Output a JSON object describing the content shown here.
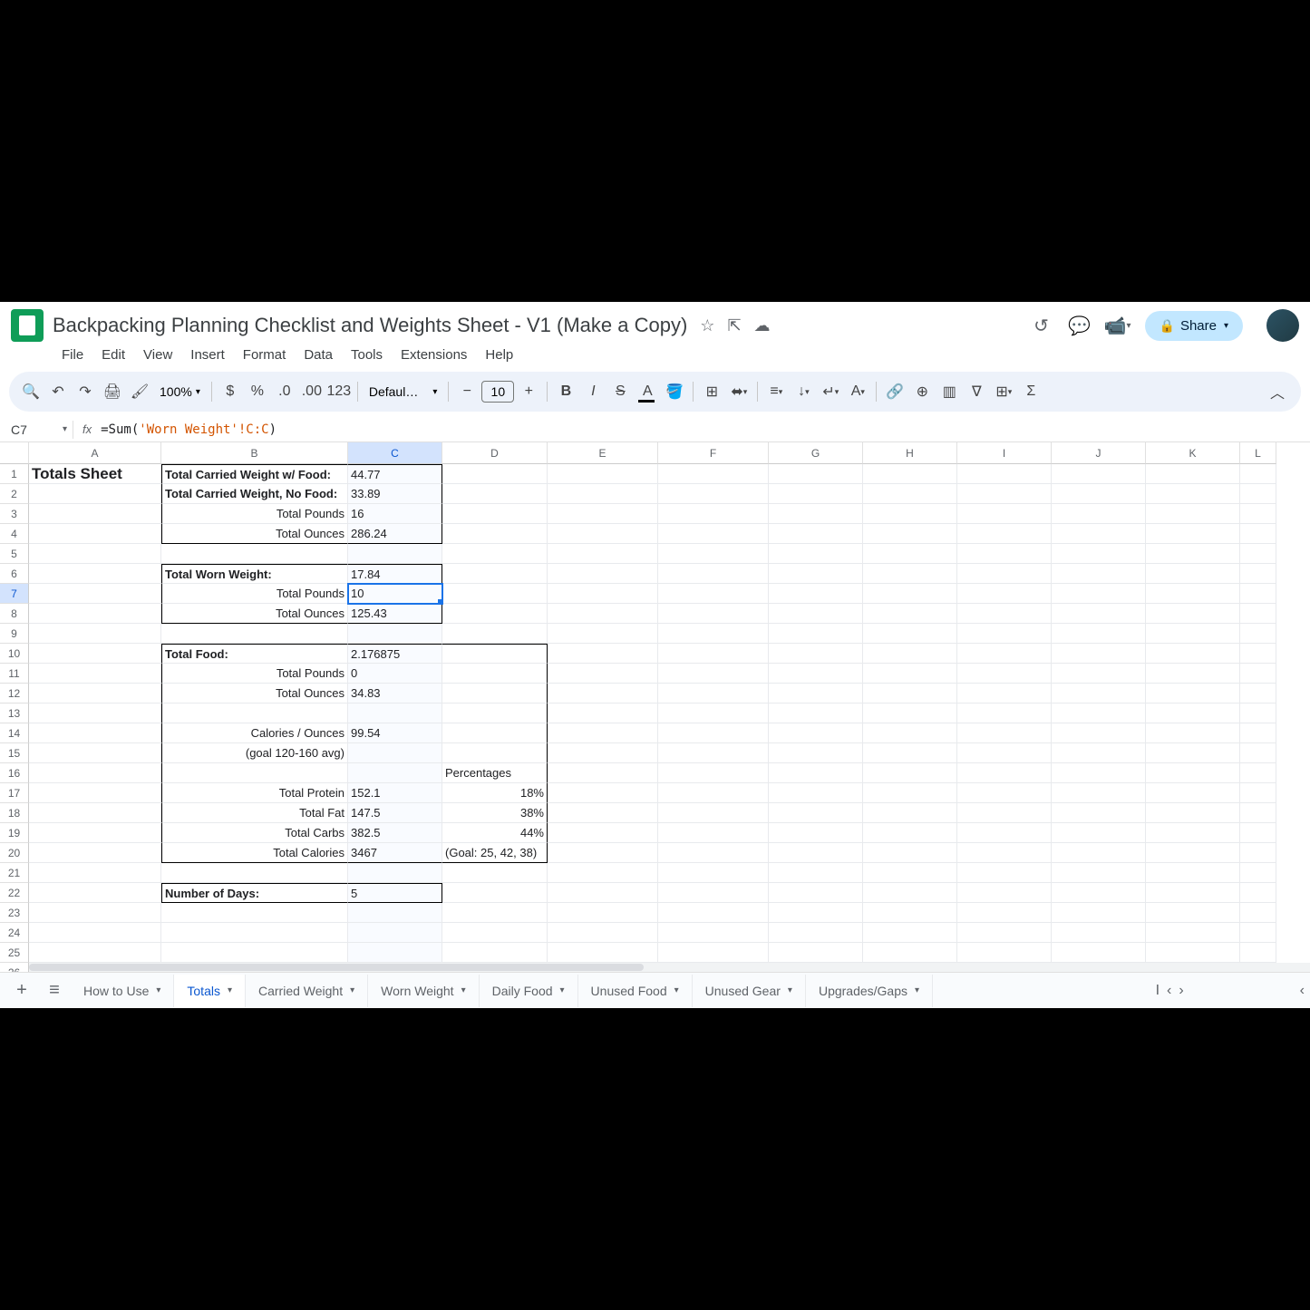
{
  "doc": {
    "title": "Backpacking Planning Checklist and Weights Sheet - V1 (Make a Copy)"
  },
  "menus": [
    "File",
    "Edit",
    "View",
    "Insert",
    "Format",
    "Data",
    "Tools",
    "Extensions",
    "Help"
  ],
  "toolbar": {
    "zoom": "100%",
    "font": "Defaul…",
    "font_size": "10"
  },
  "formula_bar": {
    "cell_ref": "C7",
    "formula_prefix": "=Sum(",
    "formula_str": "'Worn Weight'!C:C",
    "formula_suffix": ")"
  },
  "share": {
    "label": "Share"
  },
  "columns": [
    "A",
    "B",
    "C",
    "D",
    "E",
    "F",
    "G",
    "H",
    "I",
    "J",
    "K",
    "L"
  ],
  "cells": {
    "A1": "Totals Sheet",
    "B1": "Total Carried Weight w/ Food:",
    "C1": "44.77",
    "B2": "Total Carried Weight, No Food:",
    "C2": "33.89",
    "B3": "Total Pounds",
    "C3": "16",
    "B4": "Total Ounces",
    "C4": "286.24",
    "B6": "Total Worn Weight:",
    "C6": "17.84",
    "B7": "Total Pounds",
    "C7": "10",
    "B8": "Total Ounces",
    "C8": "125.43",
    "B10": "Total Food:",
    "C10": "2.176875",
    "B11": "Total Pounds",
    "C11": "0",
    "B12": "Total Ounces",
    "C12": "34.83",
    "B14": "Calories / Ounces",
    "C14": "99.54",
    "B15": "(goal 120-160 avg)",
    "D16": "Percentages",
    "B17": "Total Protein",
    "C17": "152.1",
    "D17": "18%",
    "B18": "Total Fat",
    "C18": "147.5",
    "D18": "38%",
    "B19": "Total Carbs",
    "C19": "382.5",
    "D19": "44%",
    "B20": "Total Calories",
    "C20": "3467",
    "D20": "(Goal: 25, 42, 38)",
    "B22": "Number of Days:",
    "C22": "5"
  },
  "tabs": [
    "How to Use",
    "Totals",
    "Carried Weight",
    "Worn Weight",
    "Daily Food",
    "Unused Food",
    "Unused Gear",
    "Upgrades/Gaps"
  ],
  "active_tab": "Totals"
}
